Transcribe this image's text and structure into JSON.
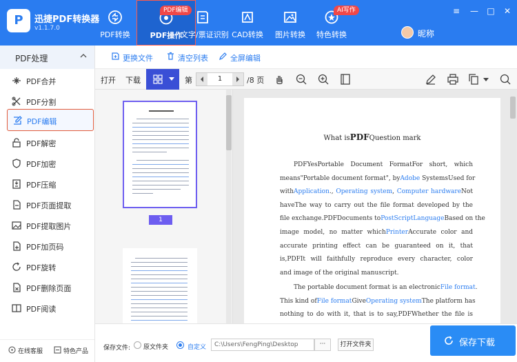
{
  "app": {
    "name": "迅捷PDF转换器",
    "version": "v1.1.7.0",
    "logo_letter": "P"
  },
  "nav": [
    {
      "label": "PDF转换",
      "icon": "convert-icon"
    },
    {
      "label": "PDF操作",
      "icon": "pdf-operate-icon",
      "badge": "PDF编辑",
      "active": true
    },
    {
      "label": "文字/票证识别",
      "icon": "ocr-icon"
    },
    {
      "label": "CAD转换",
      "icon": "cad-icon"
    },
    {
      "label": "图片转换",
      "icon": "image-icon"
    },
    {
      "label": "特色转换",
      "icon": "special-icon",
      "badge": "AI写作"
    }
  ],
  "user": {
    "name": "昵称"
  },
  "window_controls": {
    "menu": "≡",
    "minimize": "—",
    "maximize": "□",
    "close": "✕"
  },
  "sidebar": {
    "header": "PDF处理",
    "items": [
      {
        "label": "PDF合并",
        "icon": "merge-icon"
      },
      {
        "label": "PDF分割",
        "icon": "split-icon"
      },
      {
        "label": "PDF编辑",
        "icon": "edit-icon",
        "active": true
      },
      {
        "label": "PDF解密",
        "icon": "unlock-icon"
      },
      {
        "label": "PDF加密",
        "icon": "shield-icon"
      },
      {
        "label": "PDF压缩",
        "icon": "compress-icon"
      },
      {
        "label": "PDF页面提取",
        "icon": "page-extract-icon"
      },
      {
        "label": "PDF提取图片",
        "icon": "picture-extract-icon"
      },
      {
        "label": "PDF加页码",
        "icon": "page-number-icon"
      },
      {
        "label": "PDF旋转",
        "icon": "rotate-icon"
      },
      {
        "label": "PDF删除页面",
        "icon": "delete-page-icon"
      },
      {
        "label": "PDF阅读",
        "icon": "read-icon"
      }
    ],
    "footer": {
      "service": "在线客服",
      "products": "特色产品"
    }
  },
  "actions": {
    "replace": "更换文件",
    "clear": "清空列表",
    "fullscreen": "全屏编辑"
  },
  "toolbar": {
    "open": "打开",
    "download": "下载",
    "page_prefix": "第",
    "page_current": "1",
    "page_total": "/8 页"
  },
  "thumbnails": [
    {
      "page": "1",
      "selected": true
    },
    {
      "page": "2",
      "selected": false
    }
  ],
  "document": {
    "title_pre": "What is",
    "title_bold": "PDF",
    "title_post": "Question mark",
    "para1": [
      {
        "justify": true,
        "parts": [
          {
            "t": "PDFYesPortable  Document  FormatFor  short,  which"
          }
        ]
      },
      {
        "justify": true,
        "parts": [
          {
            "t": "means\"Portable document format\", by"
          },
          {
            "t": "Adobe",
            "link": true
          },
          {
            "t": " SystemsUsed for"
          }
        ]
      },
      {
        "justify": true,
        "parts": [
          {
            "t": "with"
          },
          {
            "t": "Application",
            "link": true
          },
          {
            "t": "., "
          },
          {
            "t": "Operating  system",
            "link": true
          },
          {
            "t": ", "
          },
          {
            "t": "Computer  hardware",
            "link": true
          },
          {
            "t": "Not"
          }
        ]
      },
      {
        "justify": true,
        "parts": [
          {
            "t": "haveThe way to carry out the file format developed by the"
          }
        ]
      },
      {
        "justify": true,
        "parts": [
          {
            "t": "file exchange.PDFDocuments to"
          },
          {
            "t": "PostScriptLanguage",
            "link": true
          },
          {
            "t": "Based on the"
          }
        ]
      },
      {
        "justify": true,
        "parts": [
          {
            "t": "image  model,  no  matter  which"
          },
          {
            "t": "Printer",
            "link": true
          },
          {
            "t": "Accurate  color  and"
          }
        ]
      },
      {
        "justify": true,
        "parts": [
          {
            "t": "accurate printing effect can be guaranteed on it, that"
          }
        ]
      },
      {
        "justify": true,
        "parts": [
          {
            "t": "is,PDFIt will faithfully reproduce every character, color"
          }
        ]
      },
      {
        "justify": false,
        "parts": [
          {
            "t": "and image of the original manuscript."
          }
        ]
      }
    ],
    "para2": [
      {
        "justify": true,
        "parts": [
          {
            "t": "The portable document format is an electronic"
          },
          {
            "t": "File format",
            "link": true
          },
          {
            "t": "."
          }
        ]
      },
      {
        "justify": true,
        "parts": [
          {
            "t": "This kind of"
          },
          {
            "t": "File format",
            "link": true
          },
          {
            "t": "Give"
          },
          {
            "t": "Operating system",
            "link": true
          },
          {
            "t": "The platform has"
          }
        ]
      },
      {
        "justify": true,
        "parts": [
          {
            "t": "nothing to do with it, that is to say,PDFWhether the file is"
          }
        ]
      }
    ]
  },
  "bottom": {
    "save_label": "保存文件:",
    "option_original": "原文件夹",
    "option_custom": "自定义",
    "path": "C:\\Users\\FengPing\\Desktop",
    "browse": "···",
    "open_folder": "打开文件夹",
    "save_button": "保存下载"
  },
  "colors": {
    "primary": "#2a7cf0",
    "badge": "#f04848",
    "highlight": "#6d5df0",
    "save": "#2a8cf5"
  }
}
